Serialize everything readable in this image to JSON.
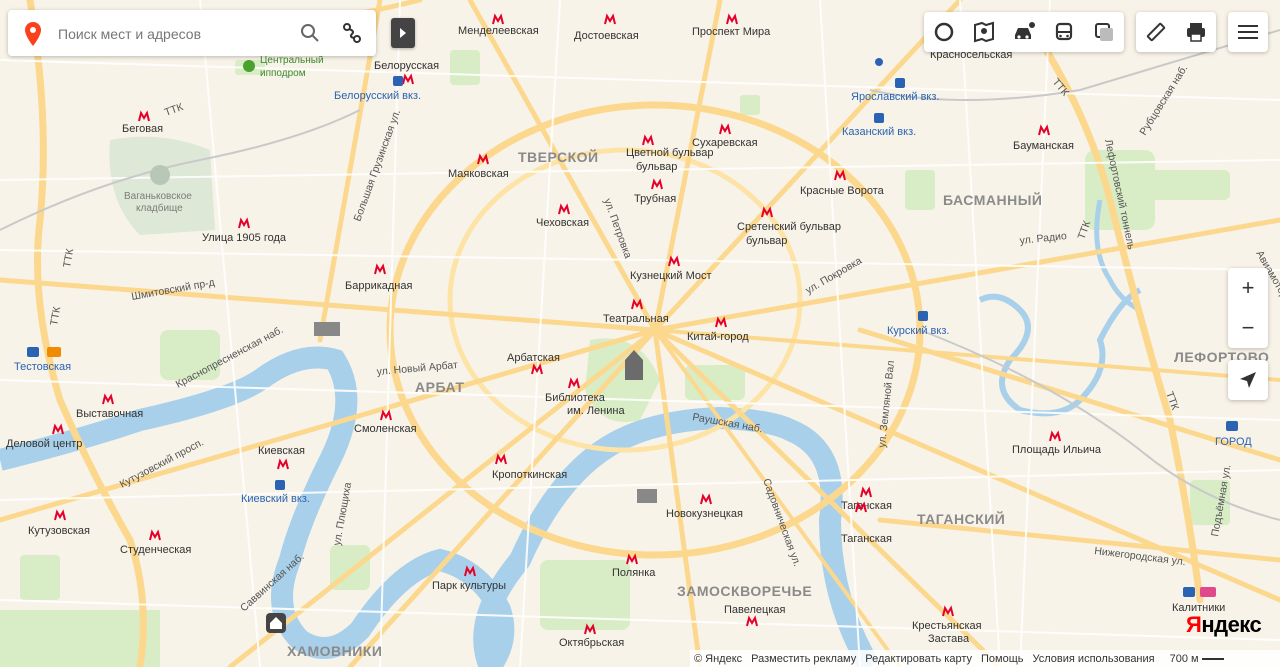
{
  "search": {
    "placeholder": "Поиск мест и адресов"
  },
  "toolbar_left": [
    "layers-icon",
    "panorama-icon",
    "traffic-icon",
    "transit-icon",
    "layers-toggle-icon"
  ],
  "toolbar_right": [
    "ruler-icon",
    "print-icon"
  ],
  "menu": "menu-icon",
  "zoom": {
    "in": "+",
    "out": "−"
  },
  "districts": [
    "ТВЕРСКОЙ",
    "БАСМАННЫЙ",
    "АРБАТ",
    "ЛЕФОРТОВО",
    "ТАГАНСКИЙ",
    "ЗАМОСКВОРЕЧЬЕ",
    "ХАМОВНИКИ"
  ],
  "metro_stations": [
    "Менделеевская",
    "Достоевская",
    "Проспект Мира",
    "Красносельская",
    "Белорусская",
    "Беговая",
    "Маяковская",
    "Цветной бульвар",
    "Сухаревская",
    "Бауманская",
    "Трубная",
    "Красные Ворота",
    "Чеховская",
    "Сретенский бульвар",
    "Улица 1905 года",
    "Баррикадная",
    "Кузнецкий Мост",
    "Театральная",
    "Китай-город",
    "Выставочная",
    "Арбатская",
    "Библиотека им. Ленина",
    "Деловой центр",
    "Смоленская",
    "Киевская",
    "Площадь Ильича",
    "Кропоткинская",
    "Кутузовская",
    "Студенческая",
    "Новокузнецкая",
    "Таганская",
    "Таганская",
    "Полянка",
    "Парк культуры",
    "Павелецкая",
    "Октябрьская",
    "Крестьянская Застава",
    "Калитники",
    "Тестовская"
  ],
  "rail_stations": [
    "Белорусский вкз.",
    "Ярославский вкз.",
    "Казанский вкз.",
    "Курский вкз.",
    "Киевский вкз.",
    "Тестовская",
    "ГОРОД"
  ],
  "streets": [
    "ТТК",
    "ТТК",
    "ТТК",
    "ТТК",
    "ТТК",
    "ТТК",
    "Большая Грузинская ул.",
    "ул. Петровка",
    "Шмитовский пр-д",
    "Краснопресненская наб.",
    "ул. Новый Арбат",
    "Кутузовский просп.",
    "Раушская наб.",
    "Садовническая ул.",
    "ул. Покровка",
    "ул. Радио",
    "Лефортовский тоннель",
    "Рубцовская наб.",
    "ул. Земляной Вал",
    "ул. Плющиха",
    "Саввинская наб.",
    "Нижегородская ул.",
    "Подъёмная ул.",
    "Авиамоторная"
  ],
  "landmarks": [
    "Центральный ипподром",
    "Ваганьковское кладбище"
  ],
  "footer": {
    "copyright": "© Яндекс",
    "ads": "Разместить рекламу",
    "edit": "Редактировать карту",
    "help": "Помощь",
    "terms": "Условия использования",
    "scale": "700 м"
  },
  "logo": {
    "first": "Я",
    "rest": "ндекс"
  },
  "colors": {
    "bg": "#f8f3e8",
    "river": "#9cc7e2",
    "road_major": "#fbd88a",
    "park": "#d4ecc0",
    "metro_red": "#e4002b"
  }
}
